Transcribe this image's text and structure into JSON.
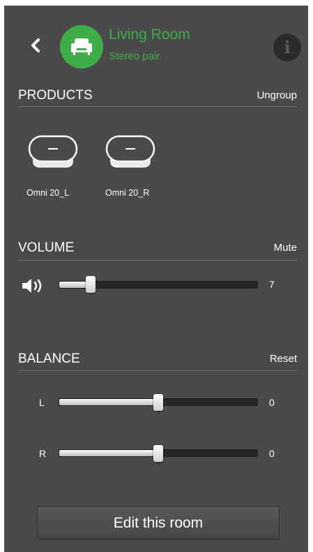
{
  "header": {
    "title": "Living Room",
    "subtitle": "Stereo pair",
    "back_icon": "chevron-left-icon",
    "room_icon": "armchair-icon",
    "info_label": "i",
    "accent_color": "#3fae49"
  },
  "products": {
    "title": "PRODUCTS",
    "action": "Ungroup",
    "items": [
      {
        "name": "Omni 20_L",
        "icon": "speaker-icon"
      },
      {
        "name": "Omni 20_R",
        "icon": "speaker-icon"
      }
    ]
  },
  "volume": {
    "title": "VOLUME",
    "action": "Mute",
    "icon": "speaker-volume-icon",
    "value": "7",
    "level_fraction": 0.16
  },
  "balance": {
    "title": "BALANCE",
    "action": "Reset",
    "sliders": [
      {
        "label": "L",
        "value": "0",
        "level_fraction": 0.5
      },
      {
        "label": "R",
        "value": "0",
        "level_fraction": 0.5
      }
    ]
  },
  "footer": {
    "edit_label": "Edit this room"
  }
}
